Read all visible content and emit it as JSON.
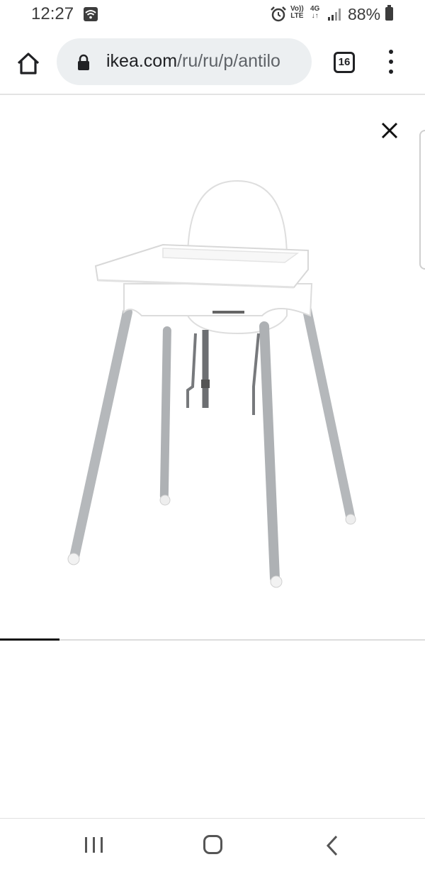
{
  "status_bar": {
    "time": "12:27",
    "volte_top": "Vo))",
    "volte_bottom": "LTE",
    "network_top": "4G",
    "network_bottom": "↓↑",
    "battery": "88%"
  },
  "browser": {
    "url_domain": "ikea.com",
    "url_path": "/ru/ru/p/antilo",
    "tab_count": "16"
  },
  "carousel": {
    "progress": 0.14
  },
  "icons": {
    "home": "home-icon",
    "lock": "lock-icon",
    "tabs": "tab-switcher-icon",
    "menu": "more-vert-icon",
    "close": "close-icon",
    "nav_recent": "recent-apps-icon",
    "nav_home": "nav-home-icon",
    "nav_back": "back-icon"
  },
  "colors": {
    "url_bar_bg": "#eceff1",
    "progress": "#111111",
    "chair_white": "#ffffff",
    "chair_legs": "#b5b8bb"
  }
}
